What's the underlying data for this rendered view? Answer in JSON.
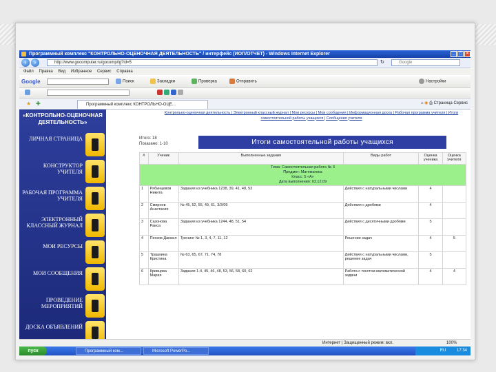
{
  "window": {
    "title": "Программный комплекс \"КОНТРОЛЬНО-ОЦЕНОЧНАЯ ДЕЯТЕЛЬНОСТЬ\" / интерфейс (ИОП/ОТЧЕТ) - Windows Internet Explorer",
    "url": "http://www.gocomputer.ru/gocomp/ig?id=5",
    "search_placeholder": "Google"
  },
  "menu": [
    "Файл",
    "Правка",
    "Вид",
    "Избранное",
    "Сервис",
    "Справка"
  ],
  "google_toolbar": {
    "logo": "Google",
    "items": [
      "Поиск",
      "Закладки",
      "Проверка",
      "Отправить",
      "Настройки"
    ]
  },
  "tab": {
    "label": "Программный комплекс КОНТРОЛЬНО-ОЦЕ...",
    "tools": [
      "Страница",
      "Сервис"
    ]
  },
  "sidebar": {
    "logo_line1": "«КОНТРОЛЬНО-ОЦЕНОЧНАЯ",
    "logo_line2": "ДЕЯТЕЛЬНОСТЬ»",
    "items": [
      {
        "label": "ЛИЧНАЯ СТРАНИЦА"
      },
      {
        "label": "КОНСТРУКТОР УЧИТЕЛЯ"
      },
      {
        "label": "РАБОЧАЯ ПРОГРАММА УЧИТЕЛЯ"
      },
      {
        "label": "ЭЛЕКТРОННЫЙ КЛАССНЫЙ ЖУРНАЛ"
      },
      {
        "label": "МОИ РЕСУРСЫ"
      },
      {
        "label": "МОИ СООБЩЕНИЯ"
      },
      {
        "label": "ПРОВЕДЕНИЕ МЕРОПРИЯТИЙ"
      },
      {
        "label": "ДОСКА ОБЪЯВЛЕНИЙ"
      }
    ]
  },
  "content": {
    "top_nav": "Контрольно-оценочная деятельность | Электронный классный журнал | Мои ресурсы | Мои сообщения | Информационная доска | Рабочая программа учителя | Итоги самостоятельной работы учащихся | Сообщения учителя",
    "page_info_1": "Итого: 18",
    "page_info_2": "Показано: 1-10",
    "heading": "Итоги самостоятельной работы учащихся",
    "table_headers": [
      "#",
      "Ученик",
      "Выполненные задания",
      "Виды работ",
      "Оценка ученика",
      "Оценка учителя"
    ],
    "green_block": [
      "Тема: Самостоятельная работа № 3",
      "Предмет: Математика",
      "Класс: 5 «А»",
      "Дата выполнения: 03.12.09"
    ],
    "rows": [
      {
        "n": "1",
        "name": "Рябинцевов Никита",
        "tasks": "Задания из учебника 1238, 39, 41, 48, 53",
        "kinds": "Действия с натуральными числами",
        "student": "4",
        "teacher": ""
      },
      {
        "n": "2",
        "name": "Смирнов Анастасия",
        "tasks": "№ 45, 52, 55, 49, 61, 3/3/09",
        "kinds": "Действия с дробями",
        "student": "4",
        "teacher": ""
      },
      {
        "n": "3",
        "name": "Сазонова Раиса",
        "tasks": "Задания из учебника 1244, 48, 51, 54",
        "kinds": "Действия с десятичными дробями",
        "student": "5",
        "teacher": ""
      },
      {
        "n": "4",
        "name": "Песков Даниил",
        "tasks": "Тренинг № 1, 3, 4, 7, 11, 12",
        "kinds": "Решение задач",
        "student": "4",
        "teacher": "5"
      },
      {
        "n": "5",
        "name": "Трашкина Кристина",
        "tasks": "№ 63, 65, 67, 71, 74, 78",
        "kinds": "Действия с натуральными числами, решение задач",
        "student": "5",
        "teacher": ""
      },
      {
        "n": "6",
        "name": "Кривцова Мария",
        "tasks": "Задания 1-4, 45, 46, 48, 53, 56, 58, 60, 62",
        "kinds": "Работа с текстом математической задачи",
        "student": "4",
        "teacher": "4"
      }
    ]
  },
  "statusbar": {
    "text": "Интернет | Защищенный режим: вкл.",
    "zoom": "100%"
  },
  "taskbar": {
    "start": "пуск",
    "tasks": [
      "Программный ком...",
      "Microsoft PowerPo..."
    ],
    "lang": "RU",
    "time": "17:34"
  }
}
